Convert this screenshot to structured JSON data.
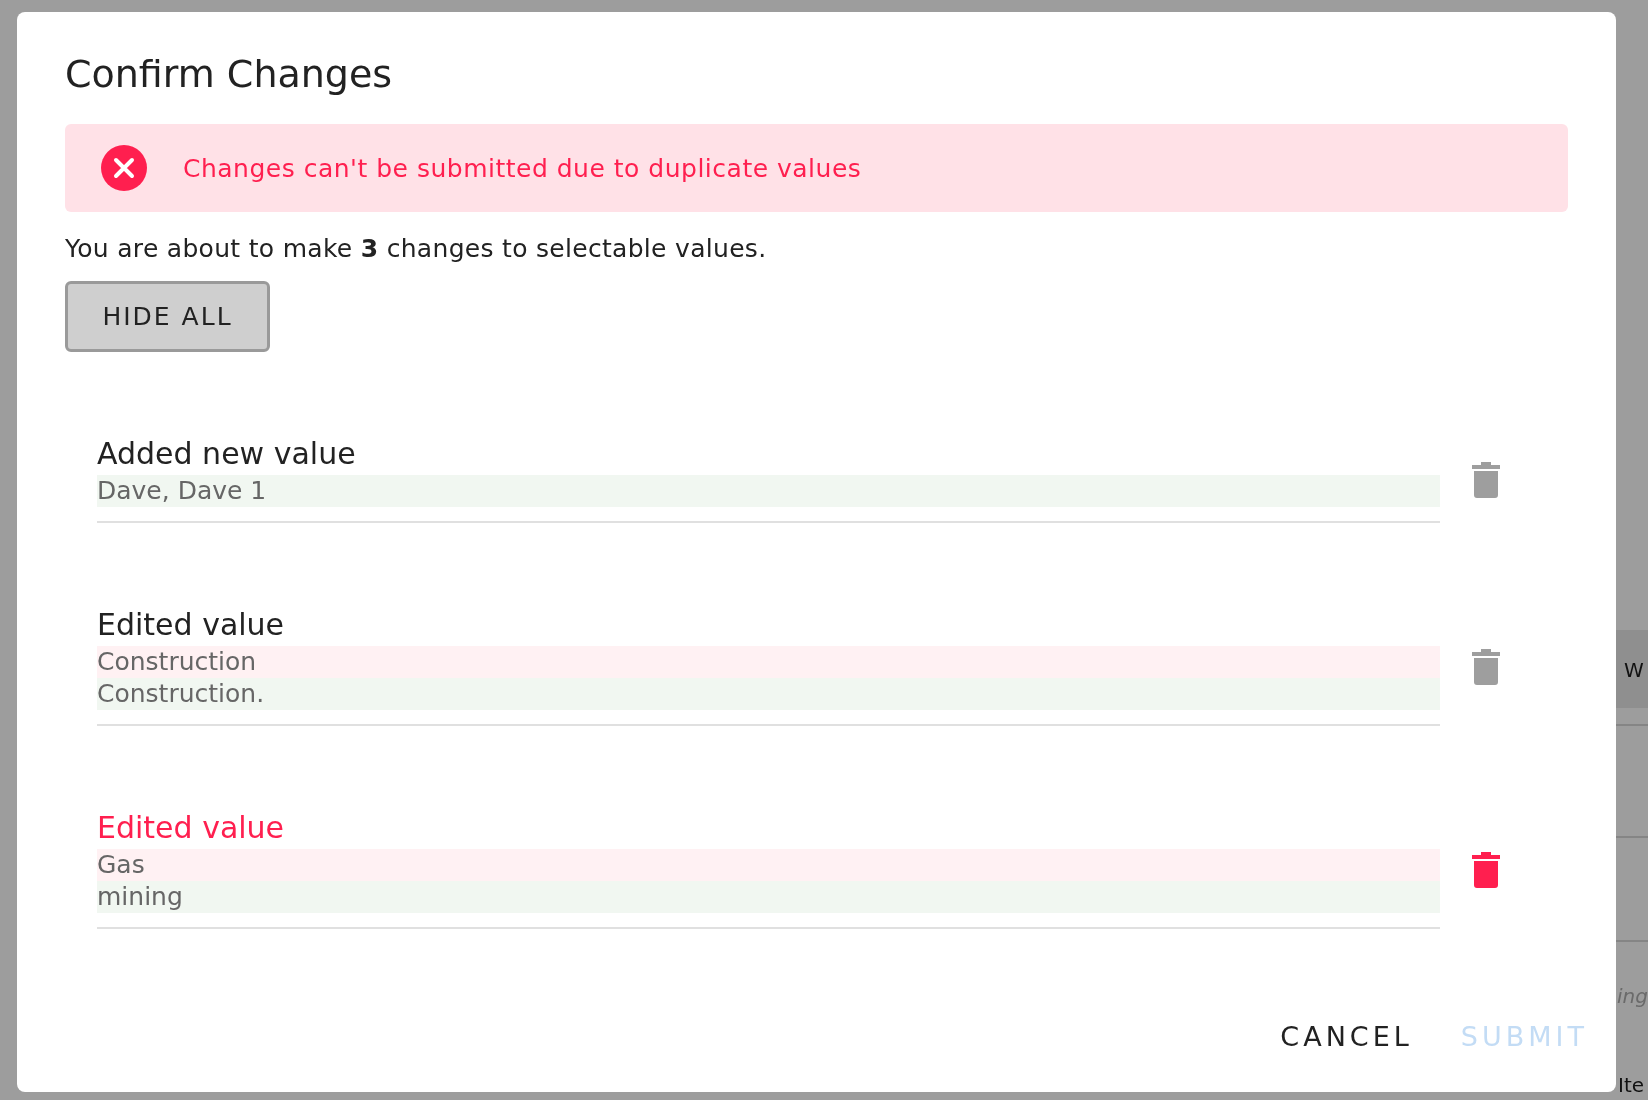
{
  "dialog": {
    "title": "Confirm Changes",
    "alert": {
      "kind": "error",
      "message": "Changes can't be submitted due to duplicate values"
    },
    "summary": "You are about to make **3** changes to selectable values.",
    "toggle_button": "HIDE ALL",
    "changes": [
      {
        "label": "Added new value",
        "error": false,
        "values": [
          {
            "kind": "added",
            "text": "Dave, Dave 1"
          }
        ]
      },
      {
        "label": "Edited value",
        "error": false,
        "values": [
          {
            "kind": "removed",
            "text": "Construction"
          },
          {
            "kind": "added",
            "text": "Construction."
          }
        ]
      },
      {
        "label": "Edited value",
        "error": true,
        "values": [
          {
            "kind": "removed",
            "text": "Gas"
          },
          {
            "kind": "added",
            "text": "mining"
          }
        ]
      }
    ],
    "buttons": [
      {
        "label": "CANCEL",
        "disabled": false
      },
      {
        "label": "SUBMIT",
        "disabled": true
      }
    ]
  },
  "background_fragments": [
    {
      "text": "W",
      "italic": false
    },
    {
      "text": "ing",
      "italic": true
    },
    {
      "text": "Ite",
      "italic": false
    }
  ]
}
